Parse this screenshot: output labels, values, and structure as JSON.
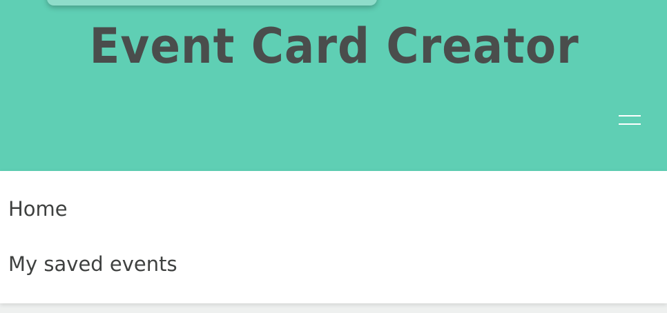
{
  "header": {
    "title": "Event Card Creator",
    "menu_icon": "hamburger-menu-icon",
    "background_color": "#5fcfb4",
    "title_color": "#4a4d4c"
  },
  "nav": {
    "items": [
      {
        "label": "Home"
      },
      {
        "label": "My saved events"
      }
    ]
  }
}
